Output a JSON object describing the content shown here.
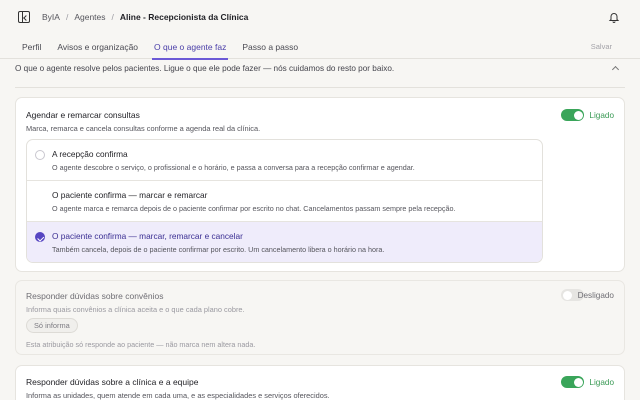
{
  "breadcrumb": {
    "root": "ByIA",
    "section": "Agentes",
    "current": "Aline - Recepcionista da Clínica",
    "separator": "/"
  },
  "tabs": [
    {
      "label": "Perfil",
      "active": false
    },
    {
      "label": "Avisos e organização",
      "active": false
    },
    {
      "label": "O que o agente faz",
      "active": true
    },
    {
      "label": "Passo a passo",
      "active": false
    }
  ],
  "save_label": "Salvar",
  "intro": "O que o agente resolve pelos pacientes. Ligue o que ele pode fazer — nós cuidamos do resto por baixo.",
  "cards": {
    "scheduling": {
      "title": "Agendar e remarcar consultas",
      "description": "Marca, remarca e cancela consultas conforme a agenda real da clínica.",
      "enabled": true,
      "toggle_label": "Ligado",
      "options": [
        {
          "title": "A recepção confirma",
          "description": "O agente descobre o serviço, o profissional e o horário, e passa a conversa para a recepção confirmar e agendar.",
          "selected": false
        },
        {
          "title": "O paciente confirma — marcar e remarcar",
          "description": "O agente marca e remarca depois de o paciente confirmar por escrito no chat. Cancelamentos passam sempre pela recepção.",
          "selected": false
        },
        {
          "title": "O paciente confirma — marcar, remarcar e cancelar",
          "description": "Também cancela, depois de o paciente confirmar por escrito. Um cancelamento libera o horário na hora.",
          "selected": true
        }
      ]
    },
    "insurance": {
      "title": "Responder dúvidas sobre convênios",
      "description": "Informa quais convênios a clínica aceita e o que cada plano cobre.",
      "enabled": false,
      "toggle_label": "Desligado",
      "chip": "Só informa",
      "note": "Esta atribuição só responde ao paciente — não marca nem altera nada."
    },
    "clinic": {
      "title": "Responder dúvidas sobre a clínica e a equipe",
      "description": "Informa as unidades, quem atende em cada uma, e as especialidades e serviços oferecidos.",
      "enabled": true,
      "toggle_label": "Ligado"
    }
  },
  "colors": {
    "accent": "#6c5ad6",
    "toggle_on": "#3aa55a",
    "selected_bg": "#efecfb"
  }
}
